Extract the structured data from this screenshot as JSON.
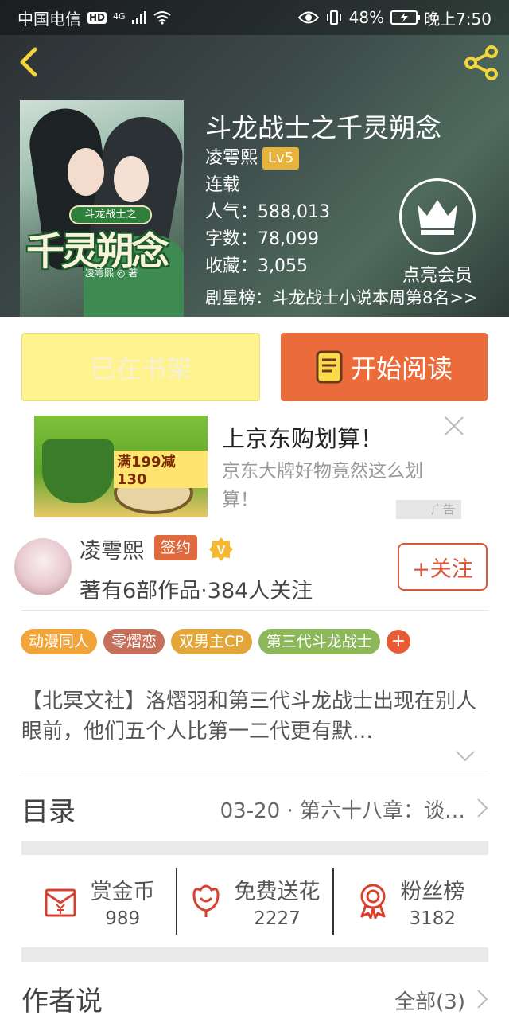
{
  "status_bar": {
    "carrier": "中国电信",
    "hd": "HD",
    "network": "4G",
    "battery": "48%",
    "time": "晚上7:50"
  },
  "book": {
    "title": "斗龙战士之千灵朔念",
    "author": "凌雩熙",
    "level": "Lv5",
    "status": "连载",
    "popularity_label": "人气：",
    "popularity": "588,013",
    "words_label": "字数：",
    "words": "78,099",
    "favorites_label": "收藏：",
    "favorites": "3,055",
    "rank_text": "剧星榜：斗龙战士小说本周第8名>>",
    "vip_label": "点亮会员"
  },
  "cover": {
    "plate_text": "斗龙战士之",
    "title_text": "千灵朔念",
    "author_text": "凌雩熙 ◎ 著"
  },
  "actions": {
    "shelf_label": "已在书架",
    "read_label": "开始阅读"
  },
  "ad": {
    "title": "上京东购划算！",
    "description": "京东大牌好物竟然这么划算！",
    "tag": "广告",
    "image_deal": "满199减130"
  },
  "author_card": {
    "name": "凌雩熙",
    "sign_badge": "签约",
    "v_badge": "V",
    "works_info": "著有6部作品·384人关注",
    "follow_label": "+关注"
  },
  "tags": [
    {
      "label": "动漫同人",
      "color": "#f0a43a"
    },
    {
      "label": "零熠恋",
      "color": "#c4705a"
    },
    {
      "label": "双男主CP",
      "color": "#e3a63a"
    },
    {
      "label": "第三代斗龙战士",
      "color": "#8cb85a"
    }
  ],
  "tag_add": "+",
  "description": "【北冥文社】洛熠羽和第三代斗龙战士出现在别人眼前，他们五个人比第一二代更有默…",
  "toc": {
    "label": "目录",
    "latest": "03-20 · 第六十八章：谈…"
  },
  "stats": [
    {
      "label": "赏金币",
      "value": "989",
      "icon": "red-envelope-icon"
    },
    {
      "label": "免费送花",
      "value": "2227",
      "icon": "flower-icon"
    },
    {
      "label": "粉丝榜",
      "value": "3182",
      "icon": "medal-icon"
    }
  ],
  "author_says": {
    "label": "作者说",
    "all": "全部(3)"
  },
  "colors": {
    "accent_orange": "#ec6b3b",
    "shelf_yellow": "#fef38c",
    "follow_red": "#d9583a",
    "icon_red": "#d9412f"
  }
}
